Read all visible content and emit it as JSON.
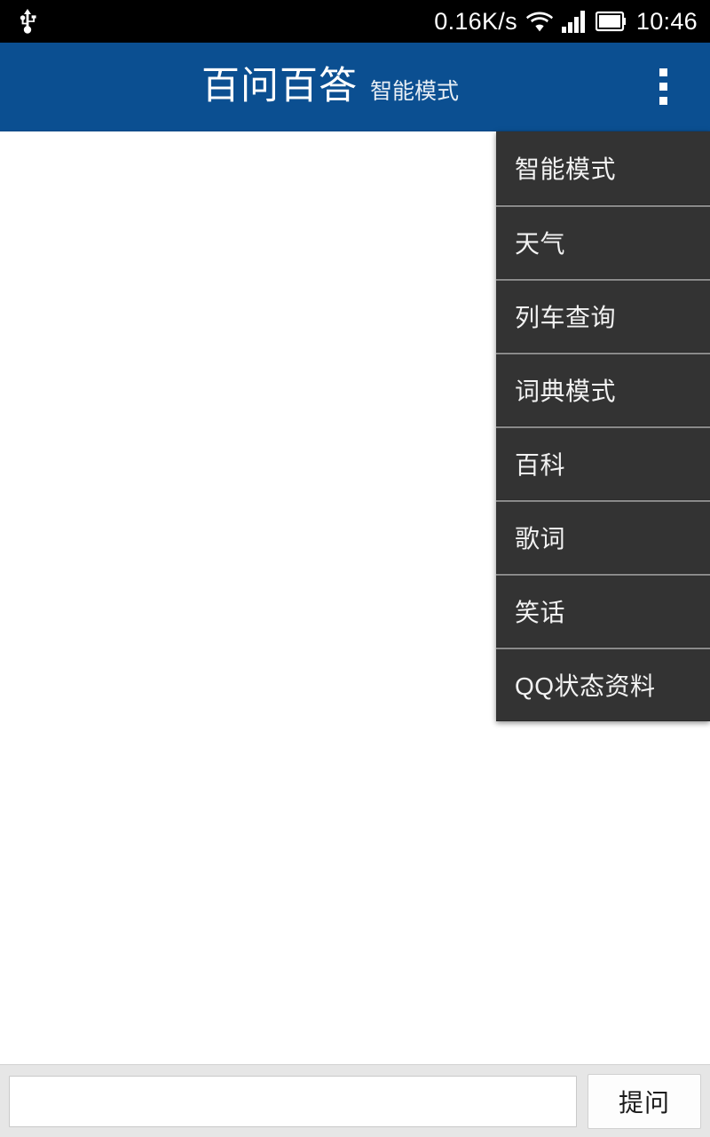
{
  "status_bar": {
    "usb_icon": "usb-icon",
    "network_speed": "0.16K/s",
    "wifi_icon": "wifi-icon",
    "signal_icon": "signal-bars-icon",
    "battery_icon": "battery-icon",
    "clock": "10:46",
    "background_color": "#000000",
    "text_color": "#ffffff"
  },
  "action_bar": {
    "title": "百问百答",
    "subtitle": "智能模式",
    "overflow_icon": "overflow-menu-icon",
    "background_color": "#0b4f91",
    "title_color": "#ffffff"
  },
  "dropdown_menu": {
    "background_color": "#333333",
    "divider_color": "#8a8a8a",
    "text_color": "#f2f2f2",
    "items": [
      {
        "label": "智能模式"
      },
      {
        "label": "天气"
      },
      {
        "label": "列车查询"
      },
      {
        "label": "词典模式"
      },
      {
        "label": "百科"
      },
      {
        "label": "歌词"
      },
      {
        "label": "笑话"
      },
      {
        "label": "QQ状态资料"
      }
    ]
  },
  "content": {
    "background_color": "#ffffff"
  },
  "input_bar": {
    "background_color": "#e6e6e6",
    "input_value": "",
    "input_placeholder": "",
    "ask_label": "提问"
  }
}
